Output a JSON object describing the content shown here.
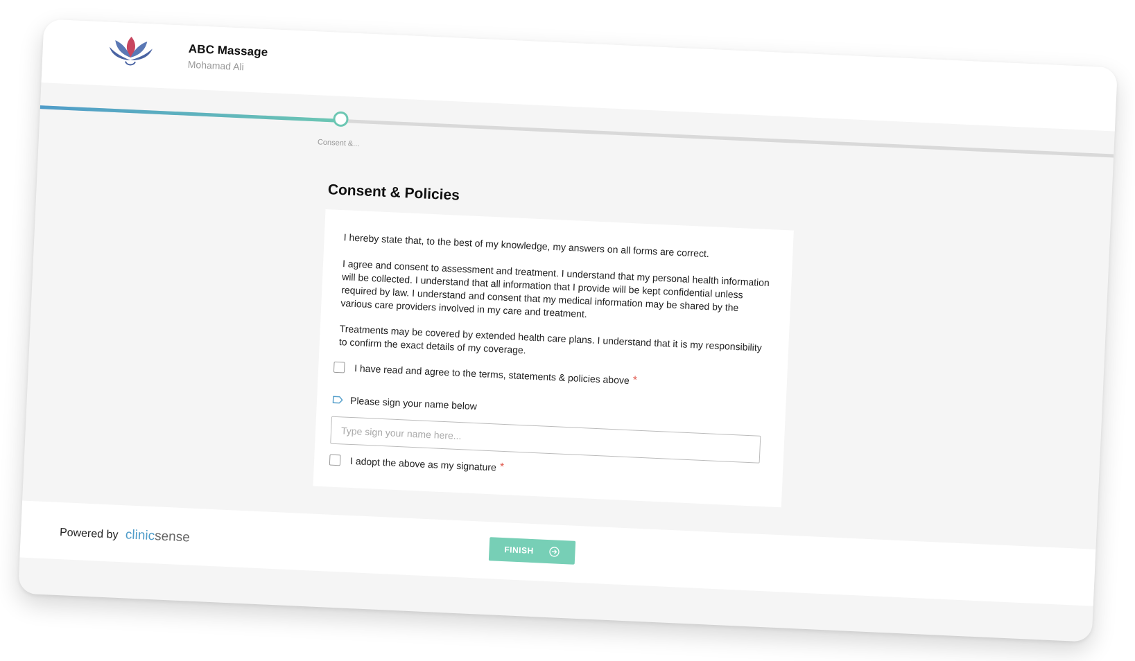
{
  "header": {
    "brand_name": "ABC Massage",
    "practitioner": "Mohamad Ali"
  },
  "progress": {
    "completed_fraction": 0.28,
    "current_step_label": "Consent &..."
  },
  "page_title": "Consent & Policies",
  "consent": {
    "paragraphs": [
      "I hereby state that, to the best of my knowledge, my answers on all forms are correct.",
      "I agree and consent to assessment and treatment. I understand that my personal health information will be collected. I understand that all information that I provide will be kept confidential unless required by law. I understand and consent that my medical information may be shared by the various care providers involved in my care and treatment.",
      "Treatments may be covered by extended health care plans. I understand that it is my responsibility to confirm the exact details of my coverage."
    ],
    "agree_label": "I have read and agree to the terms, statements & policies above",
    "required_mark": "*",
    "sign_label": "Please sign your name below",
    "sign_placeholder": "Type sign your name here...",
    "adopt_label": "I adopt the above as my signature"
  },
  "footer": {
    "powered_by": "Powered by",
    "brand_part1": "clinic",
    "brand_part2": "sense",
    "finish_label": "FINISH"
  },
  "colors": {
    "accent": "#77cfb6",
    "progress_start": "#4f9cc9",
    "required": "#e05a4e"
  }
}
